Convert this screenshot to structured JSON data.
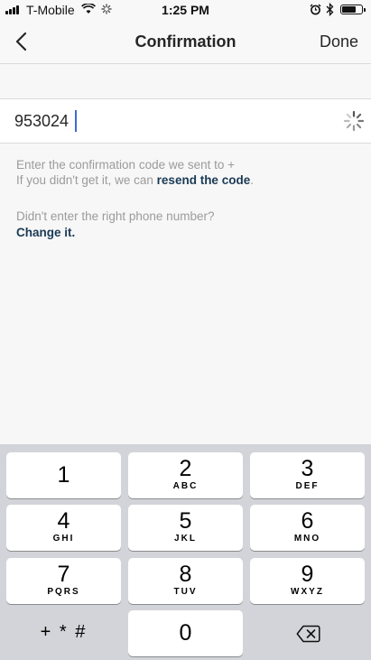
{
  "status_bar": {
    "carrier": "T-Mobile",
    "time": "1:25 PM",
    "battery_level": 0.7
  },
  "nav": {
    "title": "Confirmation",
    "done_label": "Done"
  },
  "confirmation_input": {
    "value": "953024"
  },
  "helper": {
    "line1": "Enter the confirmation code we sent to +",
    "line2_prefix": "If you didn't get it, we can ",
    "resend_link": "resend the code",
    "line2_suffix": ".",
    "wrong_number": "Didn't enter the right phone number?",
    "change_link": "Change it."
  },
  "keypad": {
    "keys": [
      {
        "num": "1",
        "letters": ""
      },
      {
        "num": "2",
        "letters": "ABC"
      },
      {
        "num": "3",
        "letters": "DEF"
      },
      {
        "num": "4",
        "letters": "GHI"
      },
      {
        "num": "5",
        "letters": "JKL"
      },
      {
        "num": "6",
        "letters": "MNO"
      },
      {
        "num": "7",
        "letters": "PQRS"
      },
      {
        "num": "8",
        "letters": "TUV"
      },
      {
        "num": "9",
        "letters": "WXYZ"
      },
      {
        "num": "0",
        "letters": ""
      }
    ],
    "symbols_label": "+ * #"
  },
  "icons": {
    "back": "chevron-left-icon",
    "wifi": "wifi-icon",
    "loading": "spinner-icon",
    "alarm": "alarm-icon",
    "bluetooth": "bluetooth-icon",
    "battery": "battery-icon",
    "delete": "backspace-icon"
  }
}
